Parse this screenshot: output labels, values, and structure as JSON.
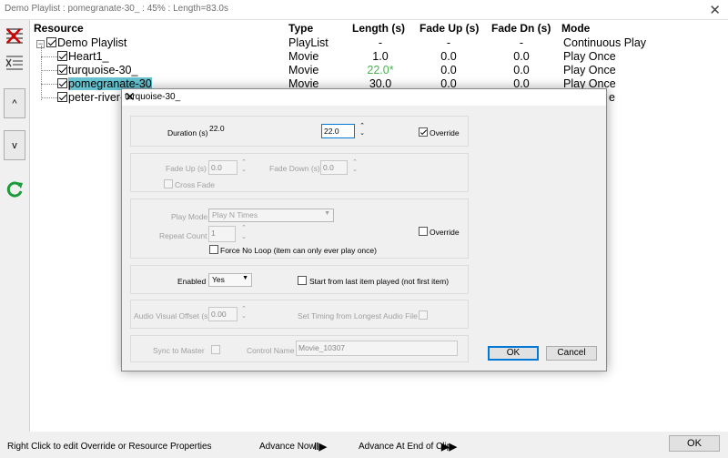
{
  "window": {
    "title": "Demo Playlist : pomegranate-30_ : 45% : Length=83.0s",
    "close": "✕"
  },
  "columns": [
    "Resource",
    "Type",
    "Length (s)",
    "Fade Up (s)",
    "Fade Dn (s)",
    "Mode"
  ],
  "rows": [
    {
      "name": "Demo Playlist",
      "type": "PlayList",
      "length": "-",
      "fadeup": "-",
      "fadedn": "-",
      "mode": "Continuous Play"
    },
    {
      "name": "Heart1_",
      "type": "Movie",
      "length": "1.0",
      "fadeup": "0.0",
      "fadedn": "0.0",
      "mode": "Play Once"
    },
    {
      "name": "turquoise-30_",
      "type": "Movie",
      "length": "22.0*",
      "fadeup": "0.0",
      "fadedn": "0.0",
      "mode": "Play Once"
    },
    {
      "name": "pomegranate-30",
      "type": "Movie",
      "length": "30.0",
      "fadeup": "0.0",
      "fadedn": "0.0",
      "mode": "Play Once"
    },
    {
      "name": "peter-river-",
      "mode": "e"
    }
  ],
  "toolbar": {
    "up": "^",
    "down": "v"
  },
  "status": {
    "hint": "Right Click to edit Override or Resource Properties",
    "advance_now": "Advance Now",
    "advance_end": "Advance At End of Clip",
    "ok": "OK"
  },
  "dialog": {
    "title": "turquoise-30_",
    "close": "✕",
    "duration_label": "Duration (s)",
    "duration_value": "22.0",
    "duration_input": "22.0",
    "override": "Override",
    "fade_up_label": "Fade Up (s)",
    "fade_up_value": "0.0",
    "fade_down_label": "Fade Down (s)",
    "fade_down_value": "0.0",
    "cross_fade": "Cross Fade",
    "play_mode_label": "Play Mode",
    "play_mode_value": "Play N Times",
    "repeat_count_label": "Repeat Count",
    "repeat_count_value": "1",
    "override2": "Override",
    "force_no_loop": "Force No Loop (item can only ever play once)",
    "enabled_label": "Enabled",
    "enabled_value": "Yes",
    "start_from_last": "Start from last item played (not first item)",
    "av_offset_label": "Audio Visual Offset (s)",
    "av_offset_value": "0.00",
    "set_timing": "Set Timing from Longest Audio File",
    "sync_master": "Sync to Master",
    "control_name_label": "Control Name",
    "control_name_value": "Movie_10307",
    "ok": "OK",
    "cancel": "Cancel"
  }
}
